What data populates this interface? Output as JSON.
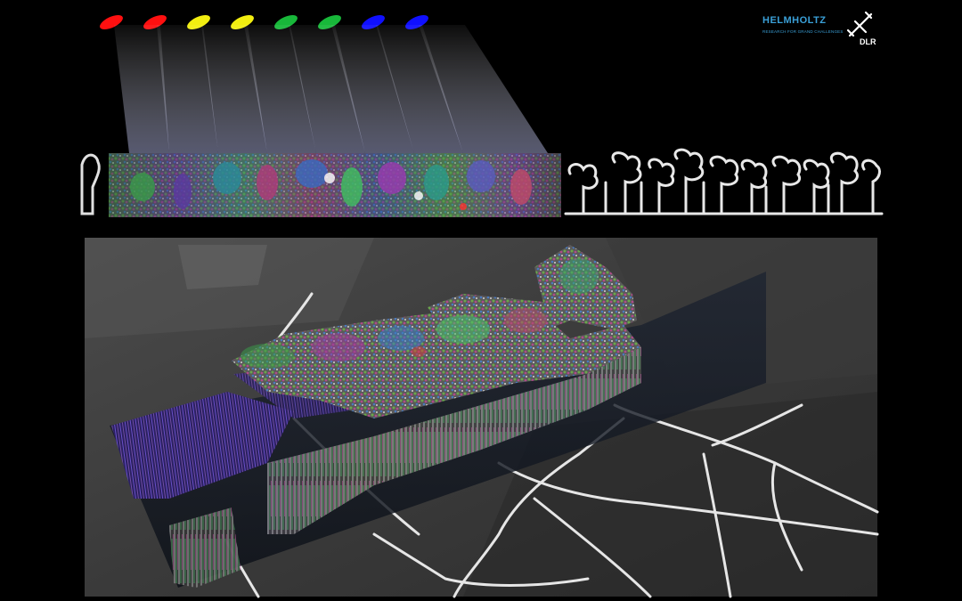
{
  "logos": {
    "helmholtz": {
      "name": "HELMHOLTZ",
      "tagline": "RESEARCH FOR GRAND CHALLENGES"
    },
    "dlr": {
      "name": "DLR"
    }
  },
  "colors": {
    "background": "#000000",
    "red": "#ff1010",
    "yellow": "#f2ee10",
    "green": "#18b83a",
    "blue": "#1010ff",
    "helmholtz_blue": "#3aa0d8",
    "road": "#e6e6e6"
  },
  "sensors": [
    {
      "color": "#ff1010"
    },
    {
      "color": "#ff1010"
    },
    {
      "color": "#f2ee10"
    },
    {
      "color": "#f2ee10"
    },
    {
      "color": "#18b83a"
    },
    {
      "color": "#18b83a"
    },
    {
      "color": "#1010ff"
    },
    {
      "color": "#1010ff"
    }
  ]
}
